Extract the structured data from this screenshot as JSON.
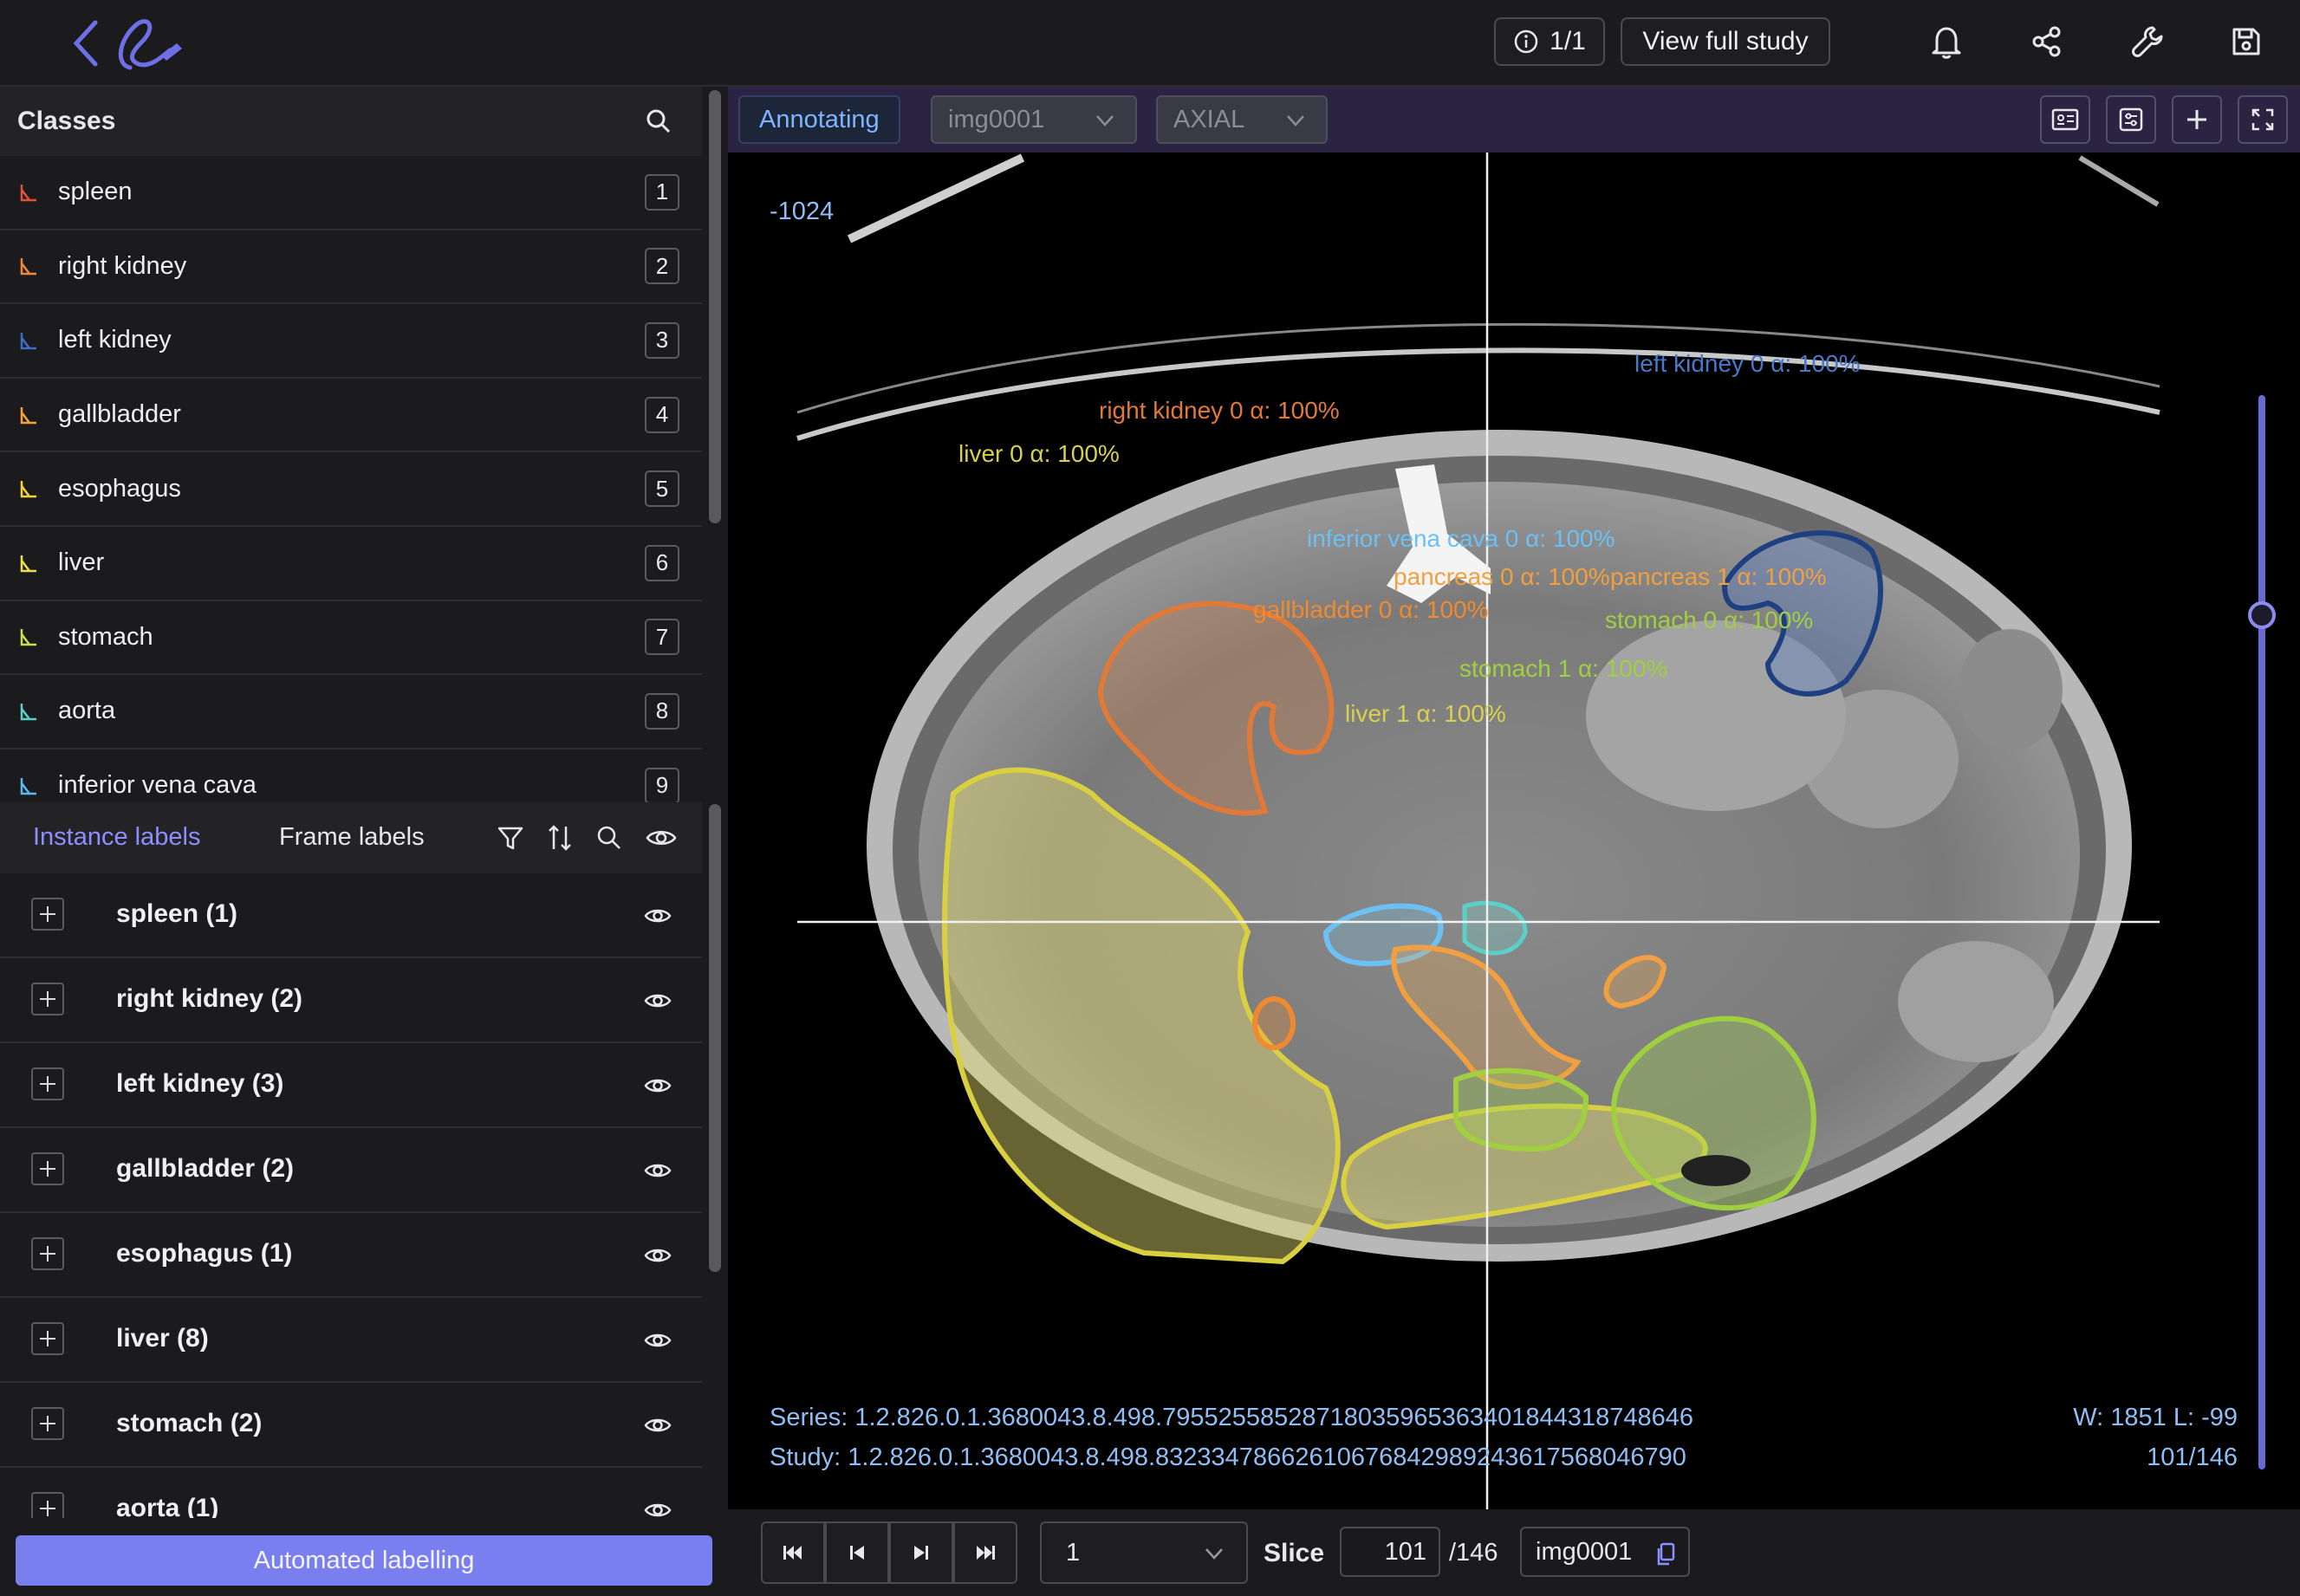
{
  "header": {
    "info_label": "1/1",
    "view_full_study_label": "View full study",
    "icons": [
      "back-icon",
      "logo-icon",
      "info-icon",
      "bell-icon",
      "share-icon",
      "wrench-icon",
      "save-icon"
    ]
  },
  "classes": {
    "title": "Classes",
    "items": [
      {
        "name": "spleen",
        "key": "1",
        "color": "#e0533a"
      },
      {
        "name": "right kidney",
        "key": "2",
        "color": "#f0883a"
      },
      {
        "name": "left kidney",
        "key": "3",
        "color": "#3a6fc4"
      },
      {
        "name": "gallbladder",
        "key": "4",
        "color": "#f3a23a"
      },
      {
        "name": "esophagus",
        "key": "5",
        "color": "#f3d23a"
      },
      {
        "name": "liver",
        "key": "6",
        "color": "#e9e04a"
      },
      {
        "name": "stomach",
        "key": "7",
        "color": "#c8e04a"
      },
      {
        "name": "aorta",
        "key": "8",
        "color": "#5ad0c8"
      },
      {
        "name": "inferior vena cava",
        "key": "9",
        "color": "#5ab8f0"
      }
    ]
  },
  "labels": {
    "tab_instance": "Instance labels",
    "tab_frame": "Frame labels",
    "instances": [
      "spleen (1)",
      "right kidney (2)",
      "left kidney (3)",
      "gallbladder (2)",
      "esophagus (1)",
      "liver (8)",
      "stomach (2)",
      "aorta (1)"
    ],
    "automated_label": "Automated labelling"
  },
  "viewer": {
    "mode_label": "Annotating",
    "image_select": "img0001",
    "orientation_select": "AXIAL",
    "hu_value": "-1024",
    "series_text": "Series: 1.2.826.0.1.3680043.8.498.79552558528718035965363401844318748646",
    "study_text": "Study: 1.2.826.0.1.3680043.8.498.83233478662610676842989243617568046790",
    "window_level": "W: 1851 L: -99",
    "slice_counter": "101/146",
    "slider_fraction": 0.69,
    "roi_labels": [
      {
        "text": "left kidney 0 α: 100%",
        "color": "#4a78c8"
      },
      {
        "text": "right kidney 0 α: 100%",
        "color": "#e07a38"
      },
      {
        "text": "liver 0 α: 100%",
        "color": "#d8d050"
      },
      {
        "text": "inferior vena cava 0 α: 100%",
        "color": "#6cc0f4"
      },
      {
        "text": "pancreas 0 α: 100%",
        "color": "#f0a040"
      },
      {
        "text": "pancreas 1 α: 100%",
        "color": "#f0a040"
      },
      {
        "text": "gallbladder 0 α: 100%",
        "color": "#f08a30"
      },
      {
        "text": "stomach 0 α: 100%",
        "color": "#a0d040"
      },
      {
        "text": "stomach 1 α: 100%",
        "color": "#a0d040"
      },
      {
        "text": "liver 1 α: 100%",
        "color": "#d8d050"
      }
    ]
  },
  "footer": {
    "frame_select": "1",
    "slice_label": "Slice",
    "slice_value": "101",
    "slice_total": "/146",
    "image_chip": "img0001"
  }
}
